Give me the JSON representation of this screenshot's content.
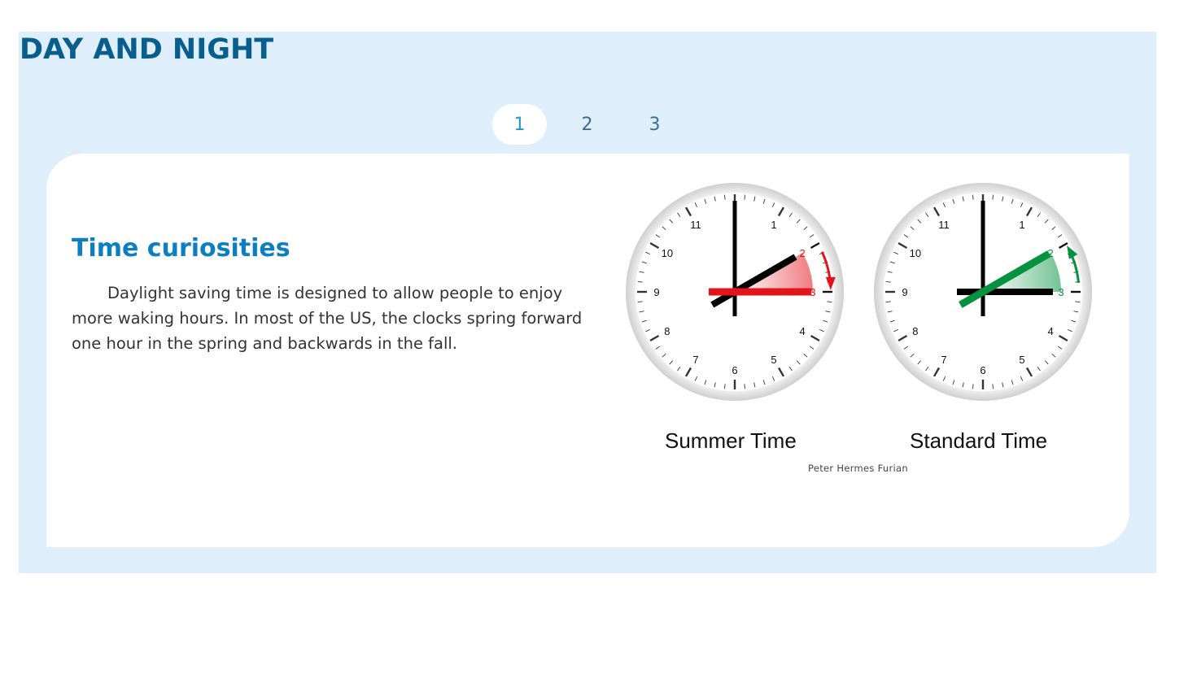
{
  "header": {
    "title": "DAY AND NIGHT"
  },
  "pagination": {
    "pages": [
      "1",
      "2",
      "3"
    ],
    "active": "1"
  },
  "card": {
    "heading": "Time curiosities",
    "body": "Daylight saving time is designed to allow people to enjoy more waking hours. In most of the US, the clocks spring forward one hour in the spring and backwards in the fall."
  },
  "figure": {
    "clocks": [
      {
        "caption": "Summer Time",
        "hour_hand_at": 3,
        "previous_hand_at": 2,
        "accent_color": "#e3131b",
        "arrow_direction": "clockwise"
      },
      {
        "caption": "Standard Time",
        "hour_hand_at": 2,
        "previous_hand_at": 3,
        "accent_color": "#05923e",
        "arrow_direction": "counterclockwise"
      }
    ],
    "credit": "Peter Hermes Furian"
  },
  "colors": {
    "panel_background": "#deeefa",
    "title": "#085f8e",
    "heading": "#0b7fc2"
  }
}
